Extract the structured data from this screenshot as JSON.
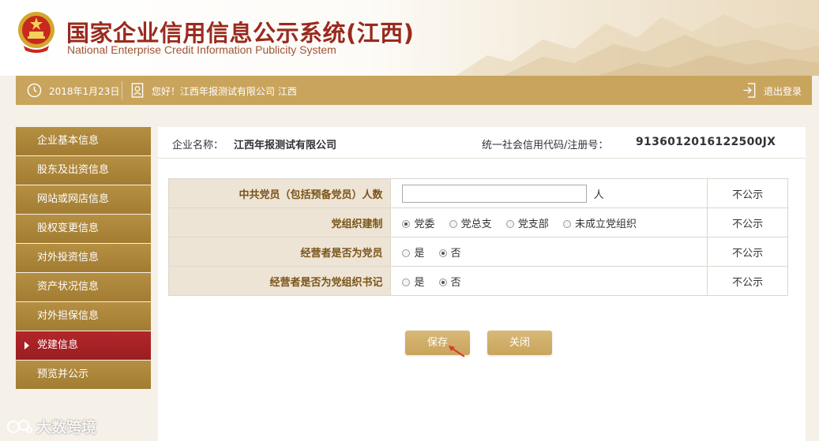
{
  "header": {
    "title_cn": "国家企业信用信息公示系统(江西)",
    "title_en": "National Enterprise Credit Information Publicity System"
  },
  "topbar": {
    "date": "2018年1月23日",
    "welcome": "您好！江西年报测试有限公司  江西",
    "logout": "退出登录"
  },
  "sidebar": {
    "items": [
      {
        "label": "企业基本信息"
      },
      {
        "label": "股东及出资信息"
      },
      {
        "label": "网站或网店信息"
      },
      {
        "label": "股权变更信息"
      },
      {
        "label": "对外投资信息"
      },
      {
        "label": "资产状况信息"
      },
      {
        "label": "对外担保信息"
      },
      {
        "label": "党建信息",
        "active": true
      },
      {
        "label": "预览并公示"
      }
    ]
  },
  "company": {
    "name_label": "企业名称：",
    "name": "江西年报测试有限公司",
    "code_label": "统一社会信用代码/注册号：",
    "code": "9136012016122500JX"
  },
  "form": {
    "rows": [
      {
        "question": "中共党员（包括预备党员）人数",
        "input_value": "",
        "unit": "人",
        "publicity": "不公示"
      },
      {
        "question": "党组织建制",
        "options": [
          "党委",
          "党总支",
          "党支部",
          "未成立党组织"
        ],
        "selected": "党委",
        "publicity": "不公示"
      },
      {
        "question": "经营者是否为党员",
        "options": [
          "是",
          "否"
        ],
        "selected": "否",
        "publicity": "不公示"
      },
      {
        "question": "经营者是否为党组织书记",
        "options": [
          "是",
          "否"
        ],
        "selected": "否",
        "publicity": "不公示"
      }
    ]
  },
  "buttons": {
    "save": "保存",
    "close": "关闭"
  },
  "watermark": "大数跨境",
  "colors": {
    "gold": "#c9a45c",
    "sidebar": "#a27c32",
    "active": "#b3262a",
    "title": "#9a2a1e"
  }
}
